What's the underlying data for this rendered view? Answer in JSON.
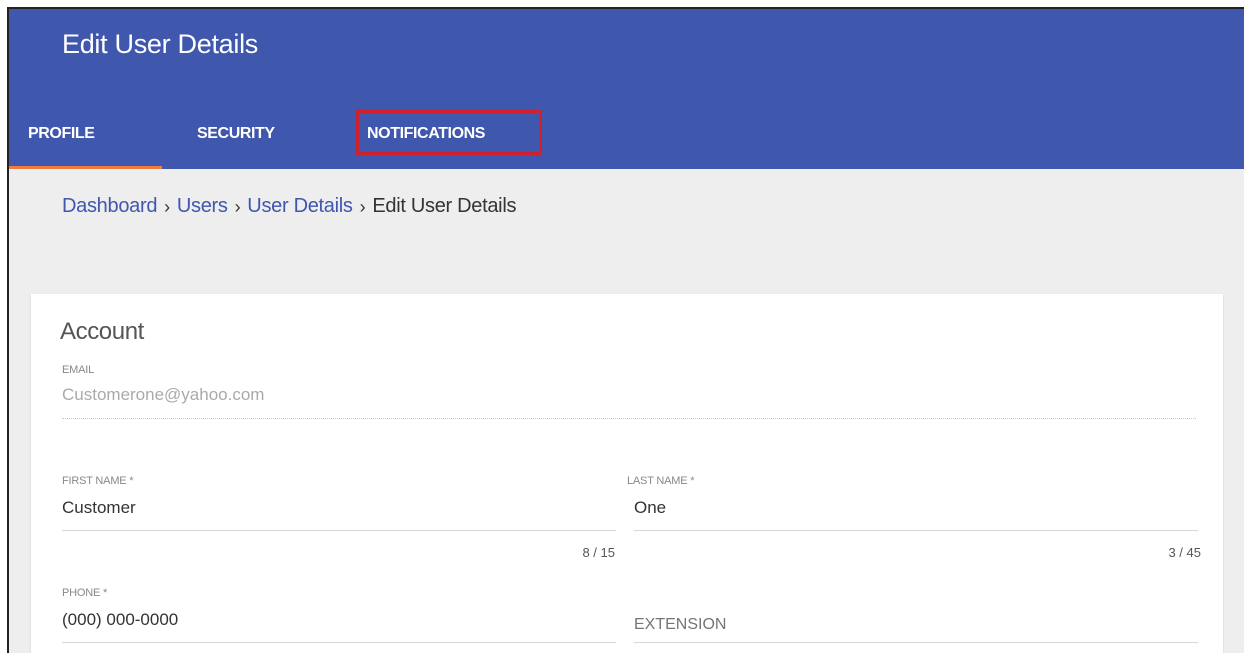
{
  "header": {
    "title": "Edit User Details",
    "tabs": [
      {
        "label": "PROFILE",
        "active": true
      },
      {
        "label": "SECURITY",
        "active": false
      },
      {
        "label": "NOTIFICATIONS",
        "active": false,
        "highlighted": true
      }
    ]
  },
  "breadcrumb": {
    "items": [
      "Dashboard",
      "Users",
      "User Details",
      "Edit User Details"
    ],
    "separator": "›"
  },
  "account": {
    "section_title": "Account",
    "email": {
      "label": "EMAIL",
      "value": "Customerone@yahoo.com"
    },
    "first_name": {
      "label": "FIRST NAME *",
      "value": "Customer",
      "counter": "8 / 15"
    },
    "last_name": {
      "label": "LAST NAME *",
      "value": "One",
      "counter": "3 / 45"
    },
    "phone": {
      "label": "PHONE *",
      "value": "(000) 000-0000"
    },
    "extension": {
      "placeholder": "EXTENSION",
      "value": ""
    }
  },
  "colors": {
    "header_bg": "#3f57ad",
    "tab_indicator": "#f07b3f",
    "highlight_box": "#d0202e",
    "link": "#3f57ad"
  }
}
